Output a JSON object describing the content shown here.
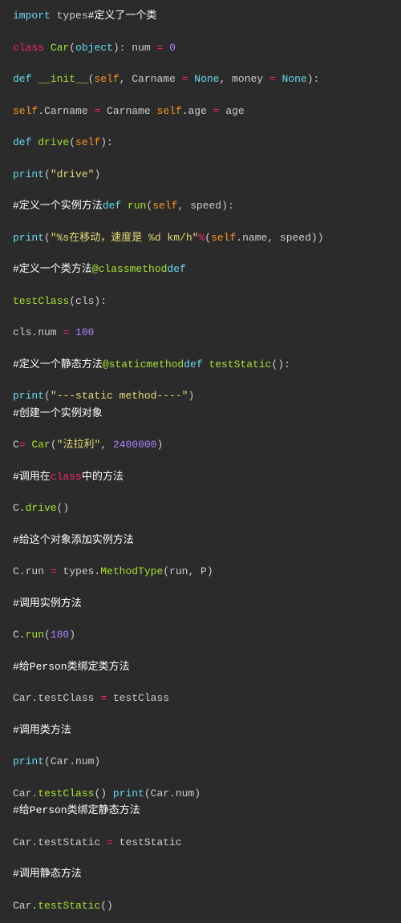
{
  "lines": {
    "l1_import": "import",
    "l1_types": " types",
    "l1_cmt": "#定义了一个类",
    "l2_class": "class",
    "l2_name": " Car",
    "l2_paren": "(",
    "l2_obj": "object",
    "l2_rest": "): num ",
    "l2_eq": "= ",
    "l2_zero": "0",
    "l3_def": "def",
    "l3_init": " __init__",
    "l3_p1": "(",
    "l3_self": "self",
    "l3_c1": ", Carname ",
    "l3_eq1": "= ",
    "l3_none1": "None",
    "l3_c2": ", money ",
    "l3_eq2": "= ",
    "l3_none2": "None",
    "l3_end": "):",
    "l4_a": "self",
    "l4_b": ".Carname ",
    "l4_eq": "= ",
    "l4_c": "Carname ",
    "l4_d": "self",
    "l4_e": ".age ",
    "l4_eq2": "= ",
    "l4_f": "age",
    "l5_def": "def",
    "l5_name": " drive",
    "l5_p": "(",
    "l5_self": "self",
    "l5_end": "):",
    "l6_print": "print",
    "l6_p": "(",
    "l6_str": "\"drive\"",
    "l6_end": ")",
    "l7_cmt": "#定义一个实例方法",
    "l7_def": "def",
    "l7_name": " run",
    "l7_p": "(",
    "l7_self": "self",
    "l7_c": ", speed):",
    "l8_print": "print",
    "l8_p": "(",
    "l8_str": "\"%s在移动，速度是 %d km/h\"",
    "l8_pct": "%",
    "l8_p2": "(",
    "l8_self": "self",
    "l8_rest": ".name, speed))",
    "l9_cmt": "#定义一个类方法",
    "l9_dec": "@classmethod",
    "l9_def": "def",
    "l10_name": "testClass",
    "l10_p": "(cls):",
    "l11_a": "cls.num ",
    "l11_eq": "= ",
    "l11_num": "100",
    "l12_cmt": "#定义一个静态方法",
    "l12_dec": "@staticmethod",
    "l12_def": "def",
    "l12_name": " testStatic",
    "l12_end": "():",
    "l13_print": "print",
    "l13_p": "(",
    "l13_str": "\"---static method----\"",
    "l13_end": ")",
    "l14_cmt": "#创建一个实例对象",
    "l15_a": "C",
    "l15_eq": "= ",
    "l15_car": "Car",
    "l15_p": "(",
    "l15_str": "\"法拉利\"",
    "l15_c": ", ",
    "l15_num": "2400000",
    "l15_end": ")",
    "l16_a": "#调用在",
    "l16_b": "class",
    "l16_c": "中的方法",
    "l17_a": "C.",
    "l17_b": "drive",
    "l17_c": "()",
    "l18_cmt": "#给这个对象添加实例方法",
    "l19_a": "C.run ",
    "l19_eq": "= ",
    "l19_b": "types.",
    "l19_c": "MethodType",
    "l19_d": "(run, P)",
    "l20_cmt": "#调用实例方法",
    "l21_a": "C.",
    "l21_b": "run",
    "l21_c": "(",
    "l21_num": "180",
    "l21_end": ")",
    "l22_cmt": "#给Person类绑定类方法",
    "l23_a": "Car.testClass ",
    "l23_eq": "= ",
    "l23_b": "testClass",
    "l24_cmt": "#调用类方法",
    "l25_print": "print",
    "l25_rest": "(Car.num)",
    "l26_a": "Car.",
    "l26_b": "testClass",
    "l26_c": "() ",
    "l26_print": "print",
    "l26_rest": "(Car.num)",
    "l27_cmt": "#给Person类绑定静态方法",
    "l28_a": "Car.testStatic ",
    "l28_eq": "= ",
    "l28_b": "testStatic",
    "l29_cmt": "#调用静态方法",
    "l30_a": "Car.",
    "l30_b": "testStatic",
    "l30_c": "()"
  }
}
